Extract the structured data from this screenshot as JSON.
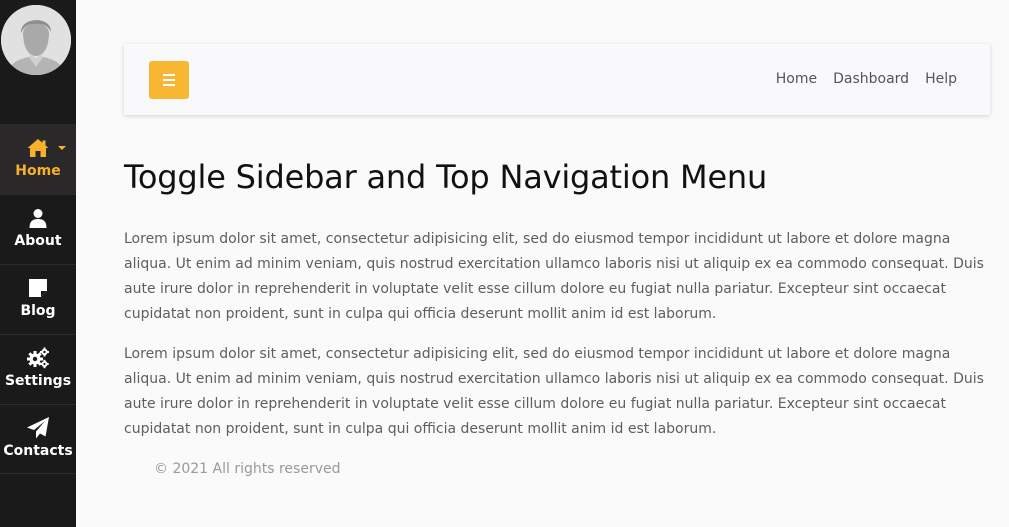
{
  "sidebar": {
    "items": [
      {
        "label": "Home",
        "icon": "home-icon",
        "active": true
      },
      {
        "label": "About",
        "icon": "user-icon",
        "active": false
      },
      {
        "label": "Blog",
        "icon": "note-icon",
        "active": false
      },
      {
        "label": "Settings",
        "icon": "cogs-icon",
        "active": false
      },
      {
        "label": "Contacts",
        "icon": "paper-plane-icon",
        "active": false
      }
    ]
  },
  "topbar": {
    "nav": [
      "Home",
      "Dashboard",
      "Help"
    ]
  },
  "main": {
    "title": "Toggle Sidebar and Top Navigation Menu",
    "paragraphs": [
      "Lorem ipsum dolor sit amet, consectetur adipisicing elit, sed do eiusmod tempor incididunt ut labore et dolore magna aliqua. Ut enim ad minim veniam, quis nostrud exercitation ullamco laboris nisi ut aliquip ex ea commodo consequat. Duis aute irure dolor in reprehenderit in voluptate velit esse cillum dolore eu fugiat nulla pariatur. Excepteur sint occaecat cupidatat non proident, sunt in culpa qui officia deserunt mollit anim id est laborum.",
      "Lorem ipsum dolor sit amet, consectetur adipisicing elit, sed do eiusmod tempor incididunt ut labore et dolore magna aliqua. Ut enim ad minim veniam, quis nostrud exercitation ullamco laboris nisi ut aliquip ex ea commodo consequat. Duis aute irure dolor in reprehenderit in voluptate velit esse cillum dolore eu fugiat nulla pariatur. Excepteur sint occaecat cupidatat non proident, sunt in culpa qui officia deserunt mollit anim id est laborum."
    ]
  },
  "footer": {
    "text": "© 2021 All rights reserved"
  },
  "colors": {
    "sidebar_bg": "#1b1a1a",
    "accent": "#f7b12c",
    "toggle_bg": "#f7b733",
    "page_bg": "#fafafa"
  }
}
